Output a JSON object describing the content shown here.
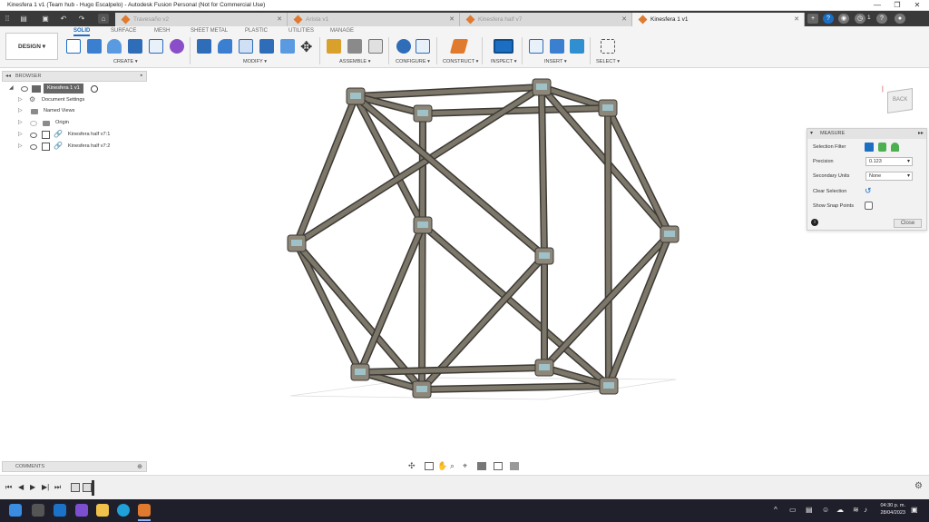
{
  "window": {
    "title": "Kinesfera 1 v1 (Team hub - Hugo Escalpelo) - Autodesk Fusion Personal (Not for Commercial Use)",
    "minimize": "—",
    "maximize": "❐",
    "close": "✕"
  },
  "tabs": [
    {
      "label": "Travesaño v2",
      "active": false
    },
    {
      "label": "Arista v1",
      "active": false
    },
    {
      "label": "Kinesfera half v7",
      "active": false
    },
    {
      "label": "Kinesfera 1 v1",
      "active": true
    }
  ],
  "tab_icons": {
    "add": "+",
    "notifications": "1"
  },
  "workspace": "DESIGN",
  "ribbon_tabs": [
    "SOLID",
    "SURFACE",
    "MESH",
    "SHEET METAL",
    "PLASTIC",
    "UTILITIES",
    "MANAGE"
  ],
  "tool_groups": [
    "CREATE ▾",
    "MODIFY ▾",
    "ASSEMBLE ▾",
    "CONFIGURE ▾",
    "CONSTRUCT ▾",
    "INSPECT ▾",
    "INSERT ▾",
    "SELECT ▾"
  ],
  "browser": {
    "title": "BROWSER",
    "root": "Kinesfera 1 v1",
    "items": [
      "Document Settings",
      "Named Views",
      "Origin",
      "Kinesfera half v7:1",
      "Kinesfera half v7:2"
    ]
  },
  "viewcube_label": "BACK",
  "measure": {
    "title": "MEASURE",
    "selection_filter_label": "Selection Filter",
    "precision_label": "Precision",
    "precision_value": "0.123",
    "secondary_units_label": "Secondary Units",
    "secondary_units_value": "None",
    "clear_selection_label": "Clear Selection",
    "show_snap_points_label": "Show Snap Points",
    "close_label": "Close"
  },
  "comments": {
    "title": "COMMENTS"
  },
  "clock": {
    "time": "04:30 p. m.",
    "date": "28/04/2023"
  },
  "colors": {
    "accent": "#1b6ec2",
    "fusion_orange": "#e07a2e",
    "frame": "#7d776a"
  }
}
